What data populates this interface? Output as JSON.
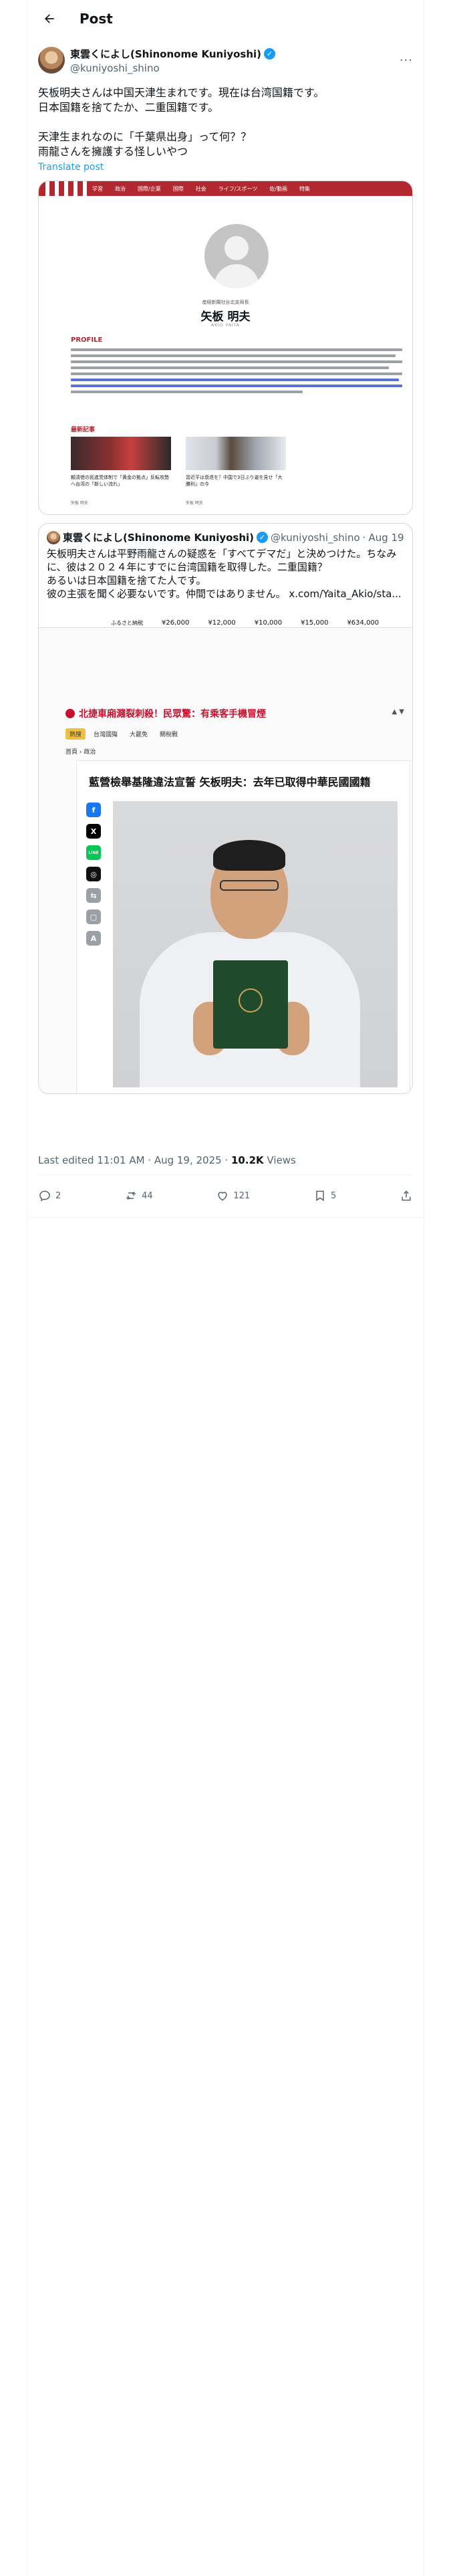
{
  "header": {
    "title": "Post"
  },
  "author": {
    "name": "東雲くによし(Shinonome Kuniyoshi)",
    "handle": "@kuniyoshi_shino"
  },
  "tweet": {
    "lines": [
      "矢板明夫さんは中国天津生まれです。現在は台湾国籍です。",
      "日本国籍を捨てたか、二重国籍です。",
      "",
      "天津生まれなのに「千葉県出身」って何？？",
      "雨龍さんを擁護する怪しいやつ"
    ],
    "translate": "Translate post"
  },
  "card": {
    "nav": [
      "学習",
      "政治",
      "国際/企業",
      "国際",
      "社会",
      "ライフ/スポーツ",
      "佐/動画",
      "特集"
    ],
    "subtitle": "産経新聞社台北支局長",
    "name": "矢板 明夫",
    "romaji": "AKIO YAITA",
    "profile_label": "PROFILE",
    "related_label": "最新記事",
    "captions": [
      "頼清徳の民進党体制で「黄金の拠点」反転攻勢へ台湾の「新しい流れ」",
      "習近平は衰退を？中国で3日ぶり姿を見せ「大勝利」の今"
    ],
    "meta": [
      "矢板 明夫",
      "矢板 明夫"
    ]
  },
  "quote": {
    "name": "東雲くによし(Shinonome Kuniyoshi)",
    "handle": "@kuniyoshi_shino",
    "date": "Aug 19",
    "lines": [
      "矢板明夫さんは平野雨龍さんの疑惑を「すべてデマだ」と決めつけた。ちなみに、彼は２０２４年にすでに台湾国籍を取得した。二重国籍？",
      "あるいは日本国籍を捨てた人です。",
      "彼の主張を聞く必要ないです。仲間ではありません。",
      "x.com/Yaita_Akio/sta..."
    ],
    "image": {
      "price_label": "ふるさと納税",
      "prices": [
        "¥26,000",
        "¥12,000",
        "¥10,000",
        "¥15,000",
        "¥634,000"
      ],
      "banner": "北捷車廂濺裂刺殺！民眾驚：有乘客手機冒煙",
      "tags": [
        "熱搜",
        "台灣國殤",
        "大罷免",
        "關稅戰"
      ],
      "crumb": "首頁 › 政治",
      "article_title": "藍營檢舉基隆違法宣誓 矢板明夫：去年已取得中華民國國籍",
      "share_icons": [
        "f",
        "X",
        "LINE",
        "◎",
        "⇆",
        "▢",
        "A"
      ]
    }
  },
  "footer": {
    "edited": "Last edited 11:01 AM · Aug 19, 2025 · ",
    "views": "10.2K",
    "views_label": " Views",
    "replies": "2",
    "reposts": "44",
    "likes": "121",
    "bookmarks": "5"
  },
  "colors": {
    "accent": "#1d9bf0",
    "brand_red": "#b22830",
    "text": "#0f1419",
    "muted": "#536471"
  }
}
